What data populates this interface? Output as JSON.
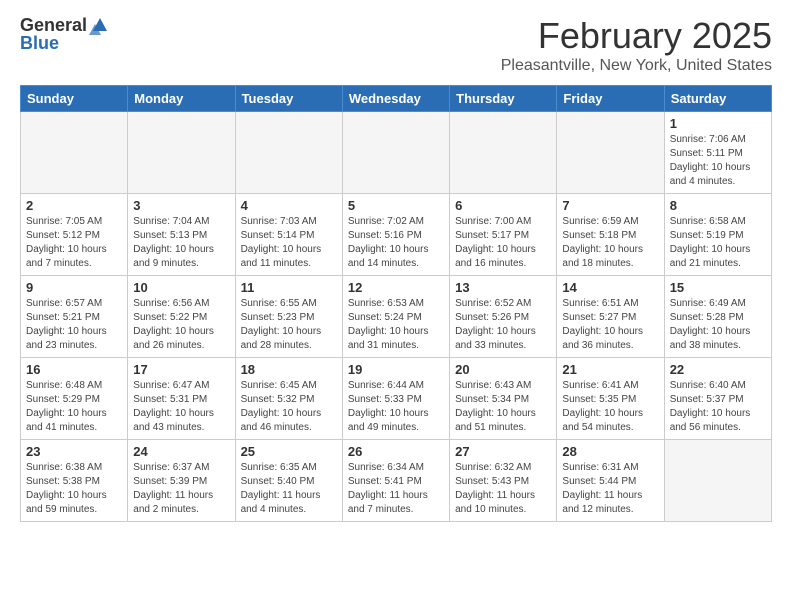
{
  "header": {
    "logo_general": "General",
    "logo_blue": "Blue",
    "month_title": "February 2025",
    "location": "Pleasantville, New York, United States"
  },
  "days_of_week": [
    "Sunday",
    "Monday",
    "Tuesday",
    "Wednesday",
    "Thursday",
    "Friday",
    "Saturday"
  ],
  "weeks": [
    {
      "days": [
        {
          "num": "",
          "detail": "",
          "empty": true
        },
        {
          "num": "",
          "detail": "",
          "empty": true
        },
        {
          "num": "",
          "detail": "",
          "empty": true
        },
        {
          "num": "",
          "detail": "",
          "empty": true
        },
        {
          "num": "",
          "detail": "",
          "empty": true
        },
        {
          "num": "",
          "detail": "",
          "empty": true
        },
        {
          "num": "1",
          "detail": "Sunrise: 7:06 AM\nSunset: 5:11 PM\nDaylight: 10 hours\nand 4 minutes.",
          "empty": false
        }
      ]
    },
    {
      "days": [
        {
          "num": "2",
          "detail": "Sunrise: 7:05 AM\nSunset: 5:12 PM\nDaylight: 10 hours\nand 7 minutes.",
          "empty": false
        },
        {
          "num": "3",
          "detail": "Sunrise: 7:04 AM\nSunset: 5:13 PM\nDaylight: 10 hours\nand 9 minutes.",
          "empty": false
        },
        {
          "num": "4",
          "detail": "Sunrise: 7:03 AM\nSunset: 5:14 PM\nDaylight: 10 hours\nand 11 minutes.",
          "empty": false
        },
        {
          "num": "5",
          "detail": "Sunrise: 7:02 AM\nSunset: 5:16 PM\nDaylight: 10 hours\nand 14 minutes.",
          "empty": false
        },
        {
          "num": "6",
          "detail": "Sunrise: 7:00 AM\nSunset: 5:17 PM\nDaylight: 10 hours\nand 16 minutes.",
          "empty": false
        },
        {
          "num": "7",
          "detail": "Sunrise: 6:59 AM\nSunset: 5:18 PM\nDaylight: 10 hours\nand 18 minutes.",
          "empty": false
        },
        {
          "num": "8",
          "detail": "Sunrise: 6:58 AM\nSunset: 5:19 PM\nDaylight: 10 hours\nand 21 minutes.",
          "empty": false
        }
      ]
    },
    {
      "days": [
        {
          "num": "9",
          "detail": "Sunrise: 6:57 AM\nSunset: 5:21 PM\nDaylight: 10 hours\nand 23 minutes.",
          "empty": false
        },
        {
          "num": "10",
          "detail": "Sunrise: 6:56 AM\nSunset: 5:22 PM\nDaylight: 10 hours\nand 26 minutes.",
          "empty": false
        },
        {
          "num": "11",
          "detail": "Sunrise: 6:55 AM\nSunset: 5:23 PM\nDaylight: 10 hours\nand 28 minutes.",
          "empty": false
        },
        {
          "num": "12",
          "detail": "Sunrise: 6:53 AM\nSunset: 5:24 PM\nDaylight: 10 hours\nand 31 minutes.",
          "empty": false
        },
        {
          "num": "13",
          "detail": "Sunrise: 6:52 AM\nSunset: 5:26 PM\nDaylight: 10 hours\nand 33 minutes.",
          "empty": false
        },
        {
          "num": "14",
          "detail": "Sunrise: 6:51 AM\nSunset: 5:27 PM\nDaylight: 10 hours\nand 36 minutes.",
          "empty": false
        },
        {
          "num": "15",
          "detail": "Sunrise: 6:49 AM\nSunset: 5:28 PM\nDaylight: 10 hours\nand 38 minutes.",
          "empty": false
        }
      ]
    },
    {
      "days": [
        {
          "num": "16",
          "detail": "Sunrise: 6:48 AM\nSunset: 5:29 PM\nDaylight: 10 hours\nand 41 minutes.",
          "empty": false
        },
        {
          "num": "17",
          "detail": "Sunrise: 6:47 AM\nSunset: 5:31 PM\nDaylight: 10 hours\nand 43 minutes.",
          "empty": false
        },
        {
          "num": "18",
          "detail": "Sunrise: 6:45 AM\nSunset: 5:32 PM\nDaylight: 10 hours\nand 46 minutes.",
          "empty": false
        },
        {
          "num": "19",
          "detail": "Sunrise: 6:44 AM\nSunset: 5:33 PM\nDaylight: 10 hours\nand 49 minutes.",
          "empty": false
        },
        {
          "num": "20",
          "detail": "Sunrise: 6:43 AM\nSunset: 5:34 PM\nDaylight: 10 hours\nand 51 minutes.",
          "empty": false
        },
        {
          "num": "21",
          "detail": "Sunrise: 6:41 AM\nSunset: 5:35 PM\nDaylight: 10 hours\nand 54 minutes.",
          "empty": false
        },
        {
          "num": "22",
          "detail": "Sunrise: 6:40 AM\nSunset: 5:37 PM\nDaylight: 10 hours\nand 56 minutes.",
          "empty": false
        }
      ]
    },
    {
      "days": [
        {
          "num": "23",
          "detail": "Sunrise: 6:38 AM\nSunset: 5:38 PM\nDaylight: 10 hours\nand 59 minutes.",
          "empty": false
        },
        {
          "num": "24",
          "detail": "Sunrise: 6:37 AM\nSunset: 5:39 PM\nDaylight: 11 hours\nand 2 minutes.",
          "empty": false
        },
        {
          "num": "25",
          "detail": "Sunrise: 6:35 AM\nSunset: 5:40 PM\nDaylight: 11 hours\nand 4 minutes.",
          "empty": false
        },
        {
          "num": "26",
          "detail": "Sunrise: 6:34 AM\nSunset: 5:41 PM\nDaylight: 11 hours\nand 7 minutes.",
          "empty": false
        },
        {
          "num": "27",
          "detail": "Sunrise: 6:32 AM\nSunset: 5:43 PM\nDaylight: 11 hours\nand 10 minutes.",
          "empty": false
        },
        {
          "num": "28",
          "detail": "Sunrise: 6:31 AM\nSunset: 5:44 PM\nDaylight: 11 hours\nand 12 minutes.",
          "empty": false
        },
        {
          "num": "",
          "detail": "",
          "empty": true
        }
      ]
    }
  ]
}
